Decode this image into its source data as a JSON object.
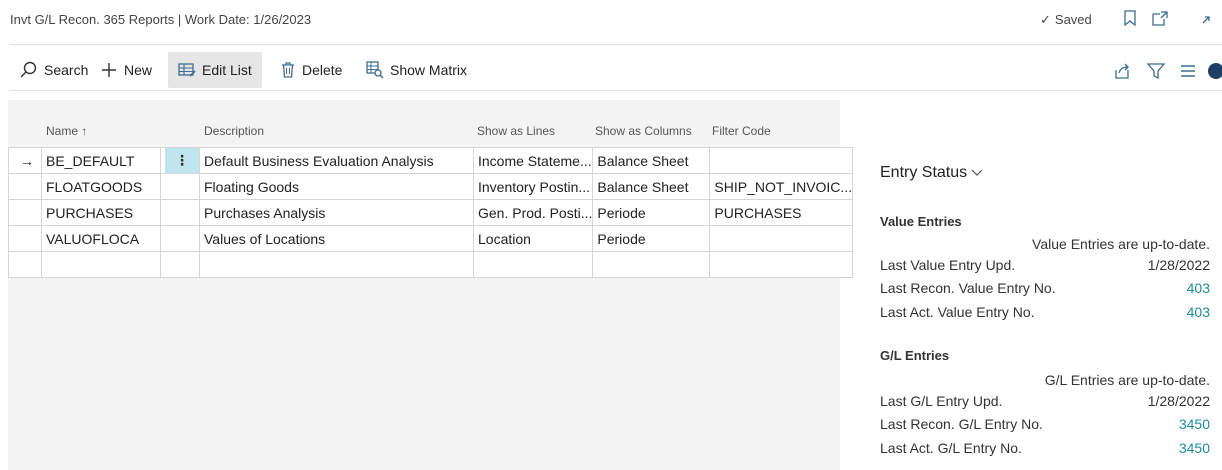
{
  "header": {
    "title": "Invt G/L Recon. 365 Reports | Work Date: 1/26/2023",
    "saved": "Saved",
    "icons": [
      "bookmark-icon",
      "open-new-window-icon",
      "expand-icon"
    ]
  },
  "actions": {
    "search": "Search",
    "new": "New",
    "edit_list": "Edit List",
    "delete": "Delete",
    "show_matrix": "Show Matrix"
  },
  "columns": {
    "name": "Name ↑",
    "description": "Description",
    "show_as_lines": "Show as Lines",
    "show_as_columns": "Show as Columns",
    "filter_code": "Filter Code"
  },
  "rows": [
    {
      "name": "BE_DEFAULT",
      "description": "Default Business Evaluation Analysis",
      "lines": "Income Stateme...",
      "columns": "Balance Sheet",
      "filter": ""
    },
    {
      "name": "FLOATGOODS",
      "description": "Floating Goods",
      "lines": "Inventory Postin...",
      "columns": "Balance Sheet",
      "filter": "SHIP_NOT_INVOIC..."
    },
    {
      "name": "PURCHASES",
      "description": "Purchases Analysis",
      "lines": "Gen. Prod. Posti...",
      "columns": "Periode",
      "filter": "PURCHASES"
    },
    {
      "name": "VALUOFLOCA",
      "description": "Values of Locations",
      "lines": "Location",
      "columns": "Periode",
      "filter": ""
    },
    {
      "name": "",
      "description": "",
      "lines": "",
      "columns": "",
      "filter": ""
    }
  ],
  "factbox": {
    "title": "Entry Status",
    "value_entries": {
      "heading": "Value Entries",
      "status": "Value Entries are up-to-date.",
      "last_upd_label": "Last Value Entry Upd.",
      "last_upd_value": "1/28/2022",
      "recon_label": "Last Recon. Value Entry No.",
      "recon_value": "403",
      "act_label": "Last Act. Value Entry No.",
      "act_value": "403"
    },
    "gl_entries": {
      "heading": "G/L Entries",
      "status": "G/L Entries are up-to-date.",
      "last_upd_label": "Last G/L Entry Upd.",
      "last_upd_value": "1/28/2022",
      "recon_label": "Last Recon. G/L Entry No.",
      "recon_value": "3450",
      "act_label": "Last Act. G/L Entry No.",
      "act_value": "3450"
    }
  },
  "colors": {
    "accent": "#1f8a9b",
    "selected_cell": "#bfe6ee",
    "grid_bg": "#f4f4f4"
  }
}
